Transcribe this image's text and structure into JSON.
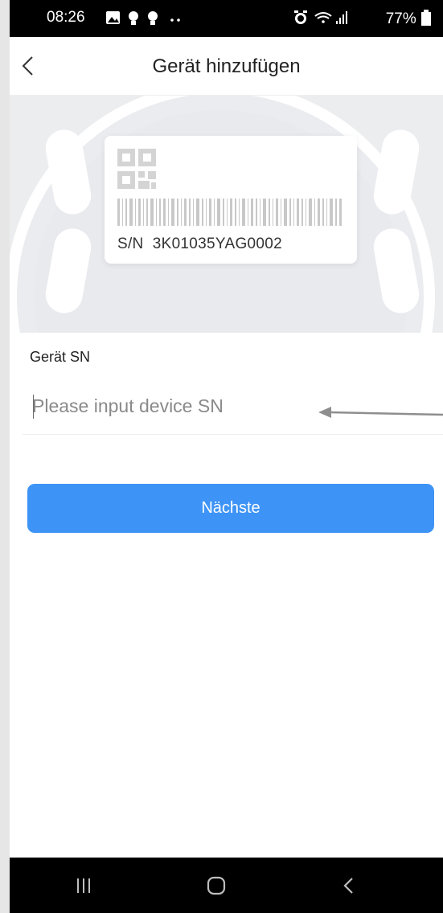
{
  "status_bar": {
    "time": "08:26",
    "left_icons": [
      "gallery-icon",
      "bulb-icon",
      "bulb-icon",
      "more-dots-icon"
    ],
    "right_icons": [
      "alarm-icon",
      "wifi-icon",
      "signal-icon",
      "battery-icon"
    ],
    "battery": "77%"
  },
  "header": {
    "title": "Gerät hinzufügen",
    "back_icon": "chevron-left-icon"
  },
  "hero": {
    "sn_text": "S/N  3K01035YAG0002",
    "qr_icon": "qr-code-icon",
    "barcode_icon": "barcode-icon"
  },
  "form": {
    "label": "Gerät SN",
    "placeholder": "Please input device SN",
    "value": ""
  },
  "next_button": "Nächste",
  "nav_bar": {
    "icons": [
      "recent-apps-icon",
      "home-icon",
      "back-icon"
    ]
  },
  "colors": {
    "accent": "#3e94f6",
    "hero_bg": "#ecedef",
    "status_bg": "#000000"
  }
}
